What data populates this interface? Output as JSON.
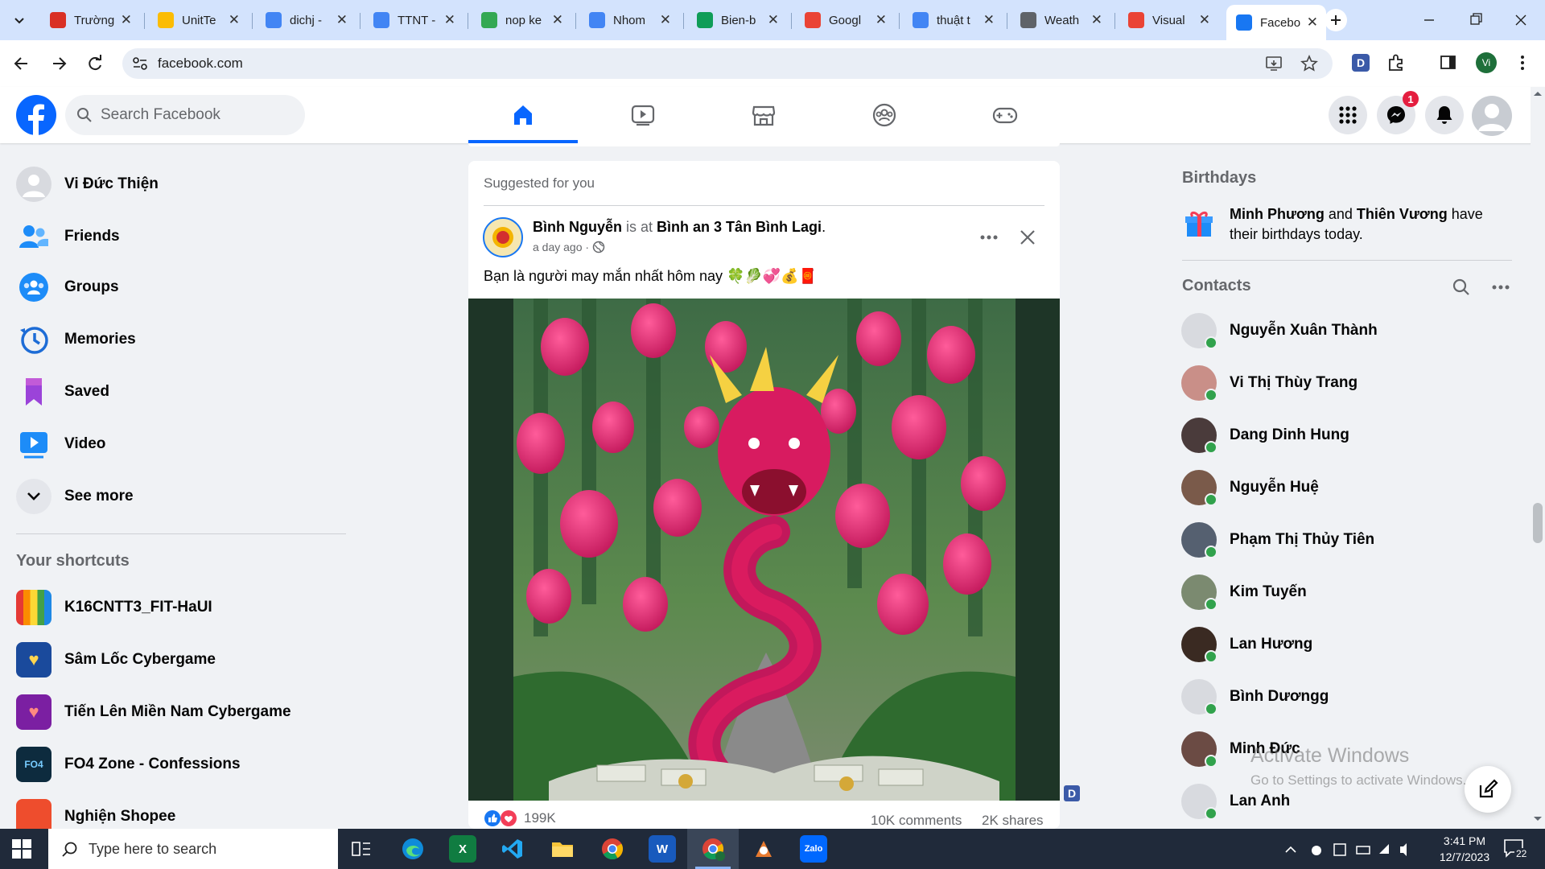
{
  "browser": {
    "tabs": [
      {
        "label": "Trường",
        "color": "#d93025"
      },
      {
        "label": "UnitTe",
        "color": "#fbbc04"
      },
      {
        "label": "dichj -",
        "color": "#4285f4"
      },
      {
        "label": "TTNT -",
        "color": "#4285f4"
      },
      {
        "label": "nop ke",
        "color": "#34a853"
      },
      {
        "label": "Nhom",
        "color": "#4285f4"
      },
      {
        "label": "Bien-b",
        "color": "#0f9d58"
      },
      {
        "label": "Googl",
        "color": "#ea4335"
      },
      {
        "label": "thuật t",
        "color": "#4285f4"
      },
      {
        "label": "Weath",
        "color": "#5f6368"
      },
      {
        "label": "Visual",
        "color": "#ea4335"
      },
      {
        "label": "Facebo",
        "color": "#1877f2"
      }
    ],
    "url": "facebook.com",
    "profile_initials": "Vi"
  },
  "facebook": {
    "search_placeholder": "Search Facebook",
    "messenger_badge": "1"
  },
  "left_sidebar": {
    "profile_name": "Vi Đức Thiện",
    "items": [
      {
        "label": "Friends"
      },
      {
        "label": "Groups"
      },
      {
        "label": "Memories"
      },
      {
        "label": "Saved"
      },
      {
        "label": "Video"
      },
      {
        "label": "See more"
      }
    ],
    "shortcuts_title": "Your shortcuts",
    "shortcuts": [
      {
        "label": "K16CNTT3_FIT-HaUI"
      },
      {
        "label": "Sâm Lốc Cybergame"
      },
      {
        "label": "Tiến Lên Miền Nam Cybergame"
      },
      {
        "label": "FO4 Zone - Confessions"
      },
      {
        "label": "Nghiện Shopee"
      }
    ]
  },
  "post": {
    "section_title": "Suggested for you",
    "author": "Bình Nguyễn",
    "is_at": "is at",
    "place": "Bình an 3 Tân Bình Lagi",
    "time": "a day ago ·",
    "text": "Bạn là người may mắn nhất hôm nay 🍀🥬💞💰🧧",
    "reactions_count": "199K",
    "comments": "10K comments",
    "shares": "2K shares"
  },
  "right_sidebar": {
    "birthdays_title": "Birthdays",
    "birthday_name1": "Minh Phương",
    "birthday_and": "and",
    "birthday_name2": "Thiên Vương",
    "birthday_rest": "have their birthdays today.",
    "contacts_title": "Contacts",
    "contacts": [
      {
        "name": "Nguyễn Xuân Thành",
        "color": "#d8dadf"
      },
      {
        "name": "Vi Thị Thùy Trang",
        "color": "#c98f88"
      },
      {
        "name": "Dang Dinh Hung",
        "color": "#4a3b3b"
      },
      {
        "name": "Nguyễn Huệ",
        "color": "#7a5a4a"
      },
      {
        "name": "Phạm Thị Thủy Tiên",
        "color": "#556070"
      },
      {
        "name": "Kim Tuyến",
        "color": "#7b8a70"
      },
      {
        "name": "Lan Hương",
        "color": "#3a2a22"
      },
      {
        "name": "Bình Dươngg",
        "color": "#d8dadf"
      },
      {
        "name": "Minh Đức",
        "color": "#6b4b44"
      },
      {
        "name": "Lan Anh",
        "color": "#d8dadf"
      }
    ]
  },
  "watermark": {
    "line1": "Activate Windows",
    "line2": "Go to Settings to activate Windows."
  },
  "taskbar": {
    "search_placeholder": "Type here to search",
    "time": "3:41 PM",
    "date": "12/7/2023",
    "notification_count": "22"
  }
}
